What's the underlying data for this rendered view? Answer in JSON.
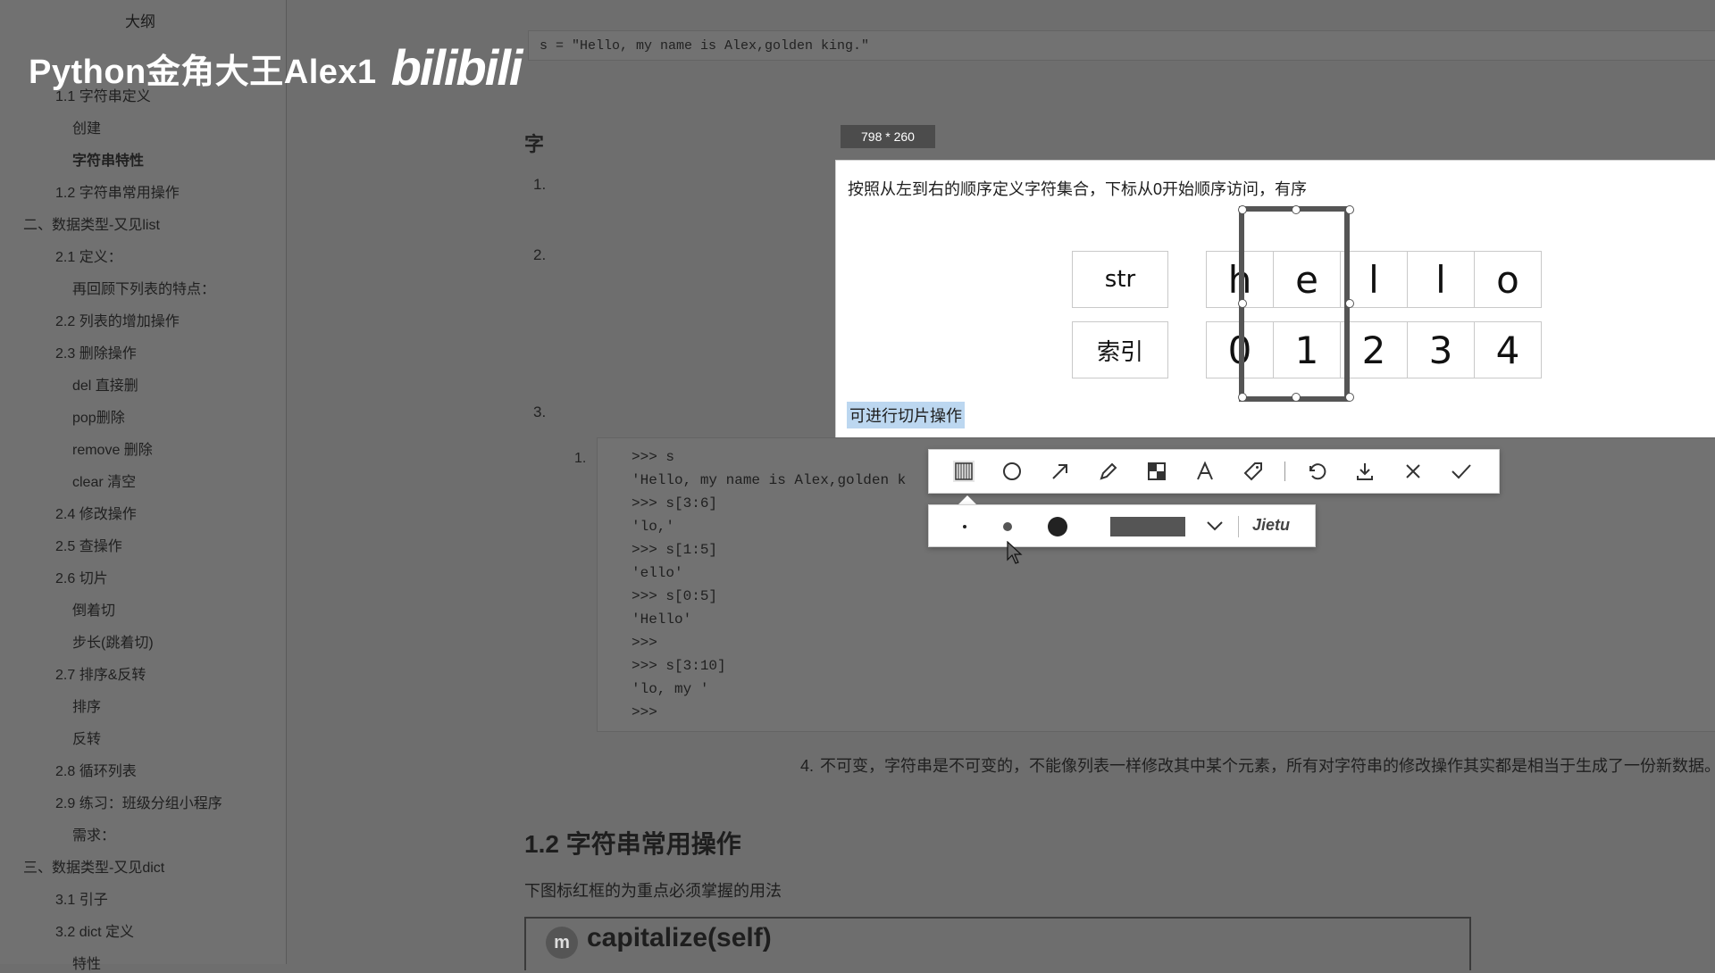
{
  "watermark": {
    "channel": "Python金角大王Alex1",
    "logo": "bilibili"
  },
  "sidebar": {
    "title": "大纲",
    "items": [
      {
        "label": "1.1 字符串定义",
        "level": 2
      },
      {
        "label": "创建",
        "level": 3
      },
      {
        "label": "字符串特性",
        "level": 3,
        "bold": true
      },
      {
        "label": "1.2 字符串常用操作",
        "level": 2
      },
      {
        "label": "二、数据类型-又见list",
        "level": 1
      },
      {
        "label": "2.1 定义：",
        "level": 2
      },
      {
        "label": "再回顾下列表的特点：",
        "level": 3
      },
      {
        "label": "2.2 列表的增加操作",
        "level": 2
      },
      {
        "label": "2.3 删除操作",
        "level": 2
      },
      {
        "label": "del 直接删",
        "level": 3
      },
      {
        "label": "pop删除",
        "level": 3
      },
      {
        "label": "remove 删除",
        "level": 3
      },
      {
        "label": "clear 清空",
        "level": 3
      },
      {
        "label": "2.4 修改操作",
        "level": 2
      },
      {
        "label": "2.5 查操作",
        "level": 2
      },
      {
        "label": "2.6 切片",
        "level": 2
      },
      {
        "label": "倒着切",
        "level": 3
      },
      {
        "label": "步长(跳着切)",
        "level": 3
      },
      {
        "label": "2.7 排序&反转",
        "level": 2
      },
      {
        "label": "排序",
        "level": 3
      },
      {
        "label": "反转",
        "level": 3
      },
      {
        "label": "2.8 循环列表",
        "level": 2
      },
      {
        "label": "2.9 练习：班级分组小程序",
        "level": 2
      },
      {
        "label": "需求：",
        "level": 3
      },
      {
        "label": "三、数据类型-又见dict",
        "level": 1
      },
      {
        "label": "3.1 引子",
        "level": 2
      },
      {
        "label": "3.2 dict 定义",
        "level": 2
      },
      {
        "label": "特性",
        "level": 3
      }
    ]
  },
  "doc": {
    "top_code": "s = \"Hello, my name is Alex,golden king.\"",
    "section_partial": "字",
    "list_numbers": [
      "1.",
      "2.",
      "3."
    ],
    "capture": {
      "size_label": "798 * 260",
      "desc": "按照从左到右的顺序定义字符集合，下标从0开始顺序访问，有序",
      "row_label_str": "str",
      "row_label_index": "索引",
      "chars": [
        "h",
        "e",
        "l",
        "l",
        "o"
      ],
      "indices": [
        "0",
        "1",
        "2",
        "3",
        "4"
      ],
      "slice_note": "可进行切片操作"
    },
    "code_num": "1.",
    "code_lines": [
      ">>> s",
      "'Hello, my name is Alex,golden k",
      ">>> s[3:6]",
      "'lo,'",
      ">>> s[1:5]",
      "'ello'",
      ">>> s[0:5]",
      "'Hello'",
      ">>>",
      ">>> s[3:10]",
      "'lo, my '",
      ">>>"
    ],
    "para4_num": "4.",
    "para4": "不可变，字符串是不可变的，不能像列表一样修改其中某个元素，所有对字符串的修改操作其实都是相当于生成了一份新数据。",
    "heading_ops": "1.2 字符串常用操作",
    "note": "下图标红框的为重点必须掌握的用法",
    "method_badge": "m",
    "method": "capitalize(self)"
  },
  "toolbar": {
    "tools": [
      "mosaic-icon",
      "circle-icon",
      "arrow-icon",
      "pencil-icon",
      "mosaic-grid-icon",
      "text-icon",
      "tag-icon",
      "undo-icon",
      "download-icon",
      "close-icon",
      "check-icon"
    ],
    "brand": "Jietu",
    "selected_color": "#555555"
  }
}
